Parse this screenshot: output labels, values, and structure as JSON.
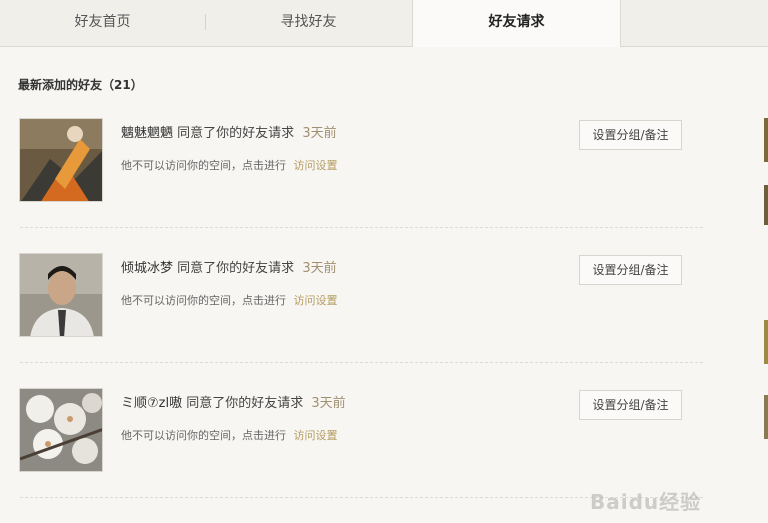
{
  "tabs": [
    {
      "label": "好友首页"
    },
    {
      "label": "寻找好友"
    },
    {
      "label": "好友请求",
      "active": true
    }
  ],
  "section": {
    "title": "最新添加的好友（21）"
  },
  "friends": [
    {
      "name": "魑魅魍魉",
      "action": "同意了你的好友请求",
      "time": "3天前",
      "note": "他不可以访问你的空间，点击进行",
      "link": "访问设置",
      "button": "设置分组/备注"
    },
    {
      "name": "倾城冰梦",
      "action": "同意了你的好友请求",
      "time": "3天前",
      "note": "他不可以访问你的空间，点击进行",
      "link": "访问设置",
      "button": "设置分组/备注"
    },
    {
      "name": "ミ顺⑦zl嗷",
      "action": "同意了你的好友请求",
      "time": "3天前",
      "note": "他不可以访问你的空间，点击进行",
      "link": "访问设置",
      "button": "设置分组/备注"
    }
  ],
  "watermark": {
    "text": "Baidu经验"
  },
  "colors": {
    "accent_link": "#b59c5e",
    "time": "#a08f70",
    "background": "#f7f6f3"
  }
}
